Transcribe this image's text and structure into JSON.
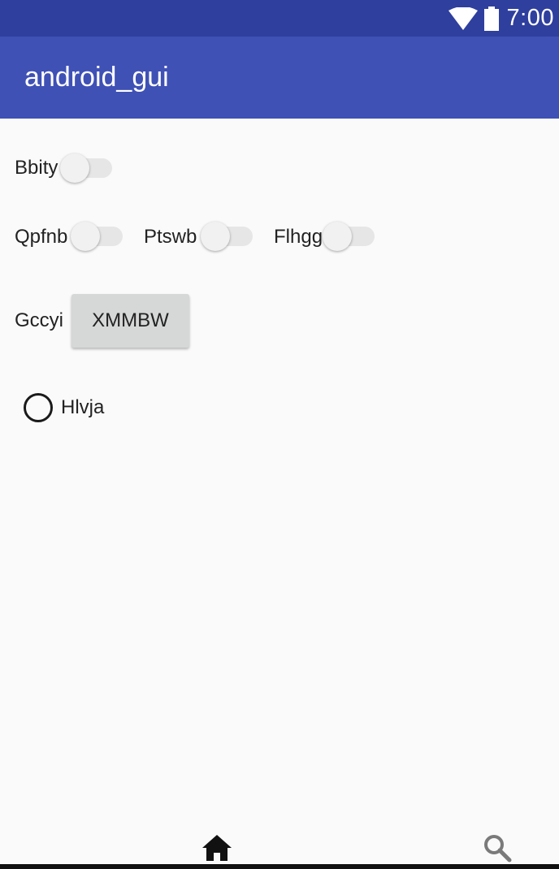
{
  "status_bar": {
    "time": "7:00",
    "icons": [
      "wifi-icon",
      "battery-icon"
    ]
  },
  "app_bar": {
    "title": "android_gui"
  },
  "switches": [
    {
      "label": "Bbity",
      "checked": false
    },
    {
      "label": "Qpfnb",
      "checked": false
    },
    {
      "label": "Ptswb",
      "checked": false
    },
    {
      "label": "Flhgg",
      "checked": false
    }
  ],
  "button_row": {
    "label": "Gccyi",
    "button_text": "XMMBW"
  },
  "radio": {
    "label": "Hlvja",
    "checked": false
  },
  "bottom_nav": {
    "icons": [
      "home-icon",
      "search-icon"
    ]
  },
  "colors": {
    "status_bar": "#2f3f9e",
    "app_bar": "#3f51b5",
    "background": "#fafafa",
    "button": "#d6d7d7"
  }
}
